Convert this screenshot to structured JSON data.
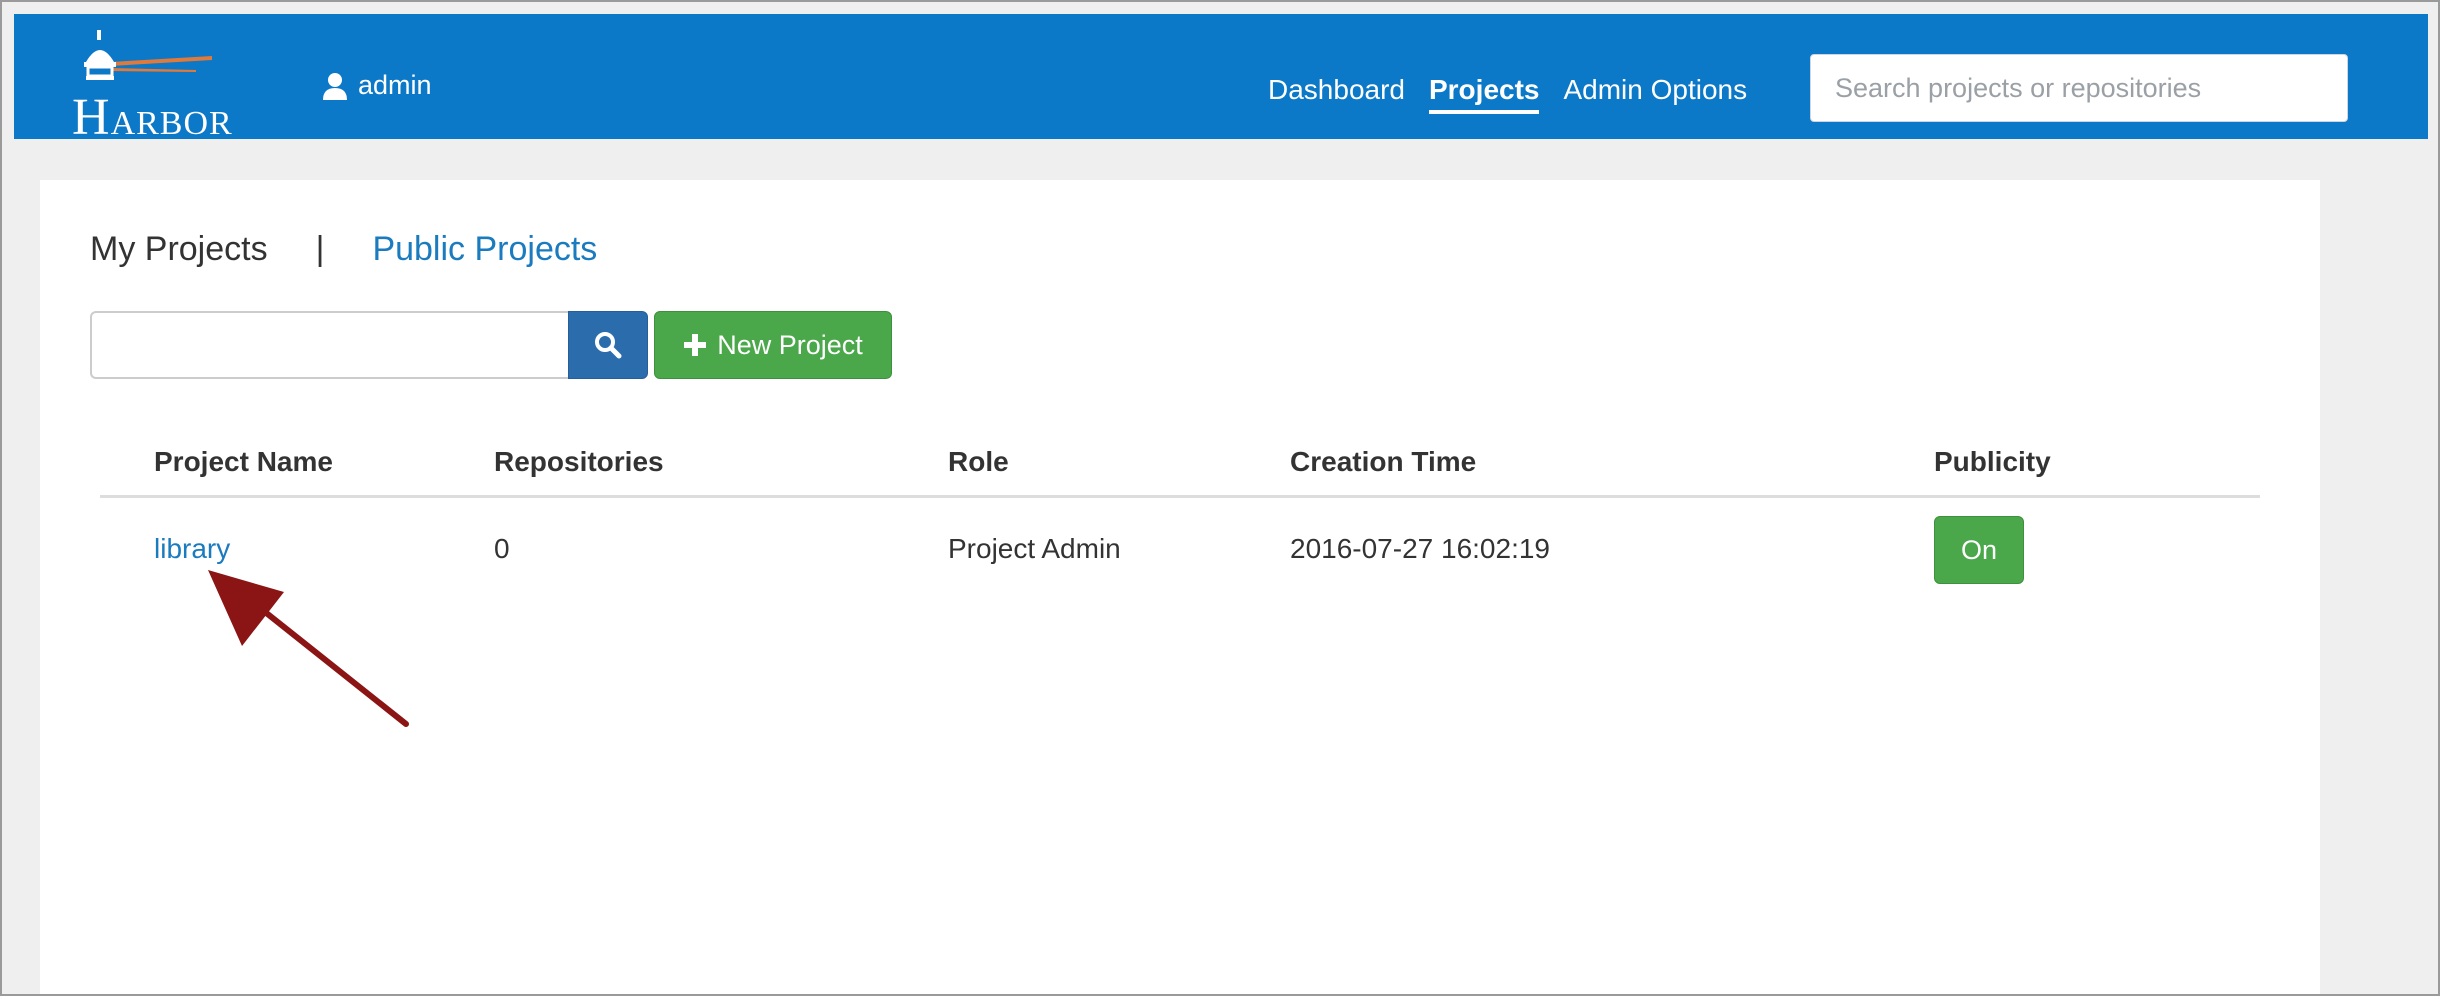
{
  "header": {
    "logo_text": "HARBOR",
    "user_name": "admin",
    "nav": [
      {
        "label": "Dashboard",
        "active": false
      },
      {
        "label": "Projects",
        "active": true
      },
      {
        "label": "Admin Options",
        "active": false
      }
    ],
    "search_placeholder": "Search projects or repositories"
  },
  "tabs": {
    "my_projects": "My Projects",
    "separator": "|",
    "public_projects": "Public Projects"
  },
  "toolbar": {
    "search_value": "",
    "new_project_label": "New Project"
  },
  "table": {
    "columns": [
      "Project Name",
      "Repositories",
      "Role",
      "Creation Time",
      "Publicity"
    ],
    "rows": [
      {
        "name": "library",
        "repositories": "0",
        "role": "Project Admin",
        "creation_time": "2016-07-27 16:02:19",
        "publicity": "On"
      }
    ]
  },
  "icons": {
    "user": "user-icon",
    "search": "search-icon",
    "plus": "plus-icon"
  },
  "colors": {
    "navbar": "#0b78c8",
    "link": "#1a7bbf",
    "success": "#4aa84a",
    "primary_button": "#2b6cad",
    "annotation_arrow": "#8b1414"
  }
}
